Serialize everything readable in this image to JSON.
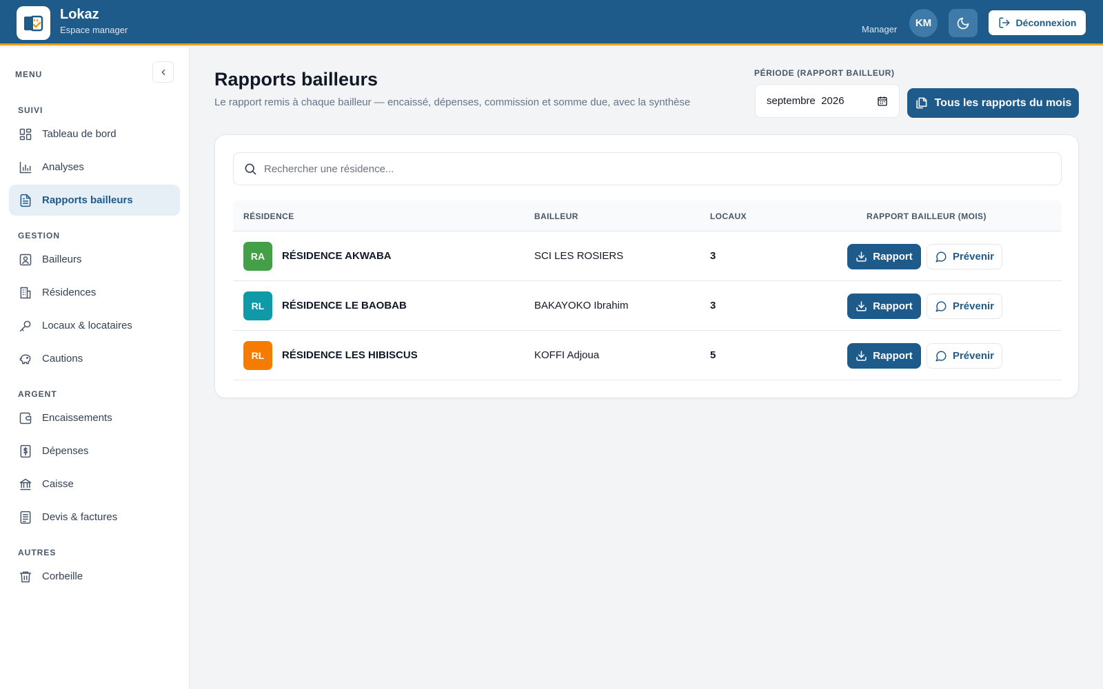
{
  "header": {
    "app_name": "Lokaz",
    "app_subtitle": "Espace manager",
    "role": "Manager",
    "avatar_initials": "KM",
    "logout_label": "Déconnexion"
  },
  "sidebar": {
    "menu_label": "MENU",
    "sections": [
      {
        "title": "SUIVI",
        "items": [
          {
            "label": "Tableau de bord",
            "icon": "dashboard-icon"
          },
          {
            "label": "Analyses",
            "icon": "chart-icon"
          },
          {
            "label": "Rapports bailleurs",
            "icon": "document-icon",
            "active": true
          }
        ]
      },
      {
        "title": "GESTION",
        "items": [
          {
            "label": "Bailleurs",
            "icon": "contact-card-icon"
          },
          {
            "label": "Résidences",
            "icon": "building-icon"
          },
          {
            "label": "Locaux & locataires",
            "icon": "key-icon"
          },
          {
            "label": "Cautions",
            "icon": "piggy-bank-icon"
          }
        ]
      },
      {
        "title": "ARGENT",
        "items": [
          {
            "label": "Encaissements",
            "icon": "wallet-icon"
          },
          {
            "label": "Dépenses",
            "icon": "receipt-dollar-icon"
          },
          {
            "label": "Caisse",
            "icon": "bank-icon"
          },
          {
            "label": "Devis & factures",
            "icon": "invoice-icon"
          }
        ]
      },
      {
        "title": "AUTRES",
        "items": [
          {
            "label": "Corbeille",
            "icon": "trash-icon"
          }
        ]
      }
    ]
  },
  "main": {
    "title": "Rapports bailleurs",
    "subtitle": "Le rapport remis à chaque bailleur — encaissé, dépenses, commission et somme due, avec la synthèse",
    "period_label": "PÉRIODE (RAPPORT BAILLEUR)",
    "period_value": "septembre  2026",
    "all_reports_label": "Tous les rapports du mois",
    "search_placeholder": "Rechercher une résidence...",
    "columns": [
      "RÉSIDENCE",
      "BAILLEUR",
      "LOCAUX",
      "RAPPORT BAILLEUR (MOIS)"
    ],
    "rows": [
      {
        "initials": "RA",
        "color": "#43a047",
        "residence": "RÉSIDENCE AKWABA",
        "owner": "SCI LES ROSIERS",
        "units": "3",
        "report_label": "Rapport",
        "notify_label": "Prévenir"
      },
      {
        "initials": "RL",
        "color": "#0e9aa7",
        "residence": "RÉSIDENCE LE BAOBAB",
        "owner": "BAKAYOKO Ibrahim",
        "units": "3",
        "report_label": "Rapport",
        "notify_label": "Prévenir"
      },
      {
        "initials": "RL",
        "color": "#f57c00",
        "residence": "RÉSIDENCE LES HIBISCUS",
        "owner": "KOFFI Adjoua",
        "units": "5",
        "report_label": "Rapport",
        "notify_label": "Prévenir"
      }
    ]
  },
  "colors": {
    "primary": "#1e5a8a",
    "accent": "#f59e0b"
  }
}
